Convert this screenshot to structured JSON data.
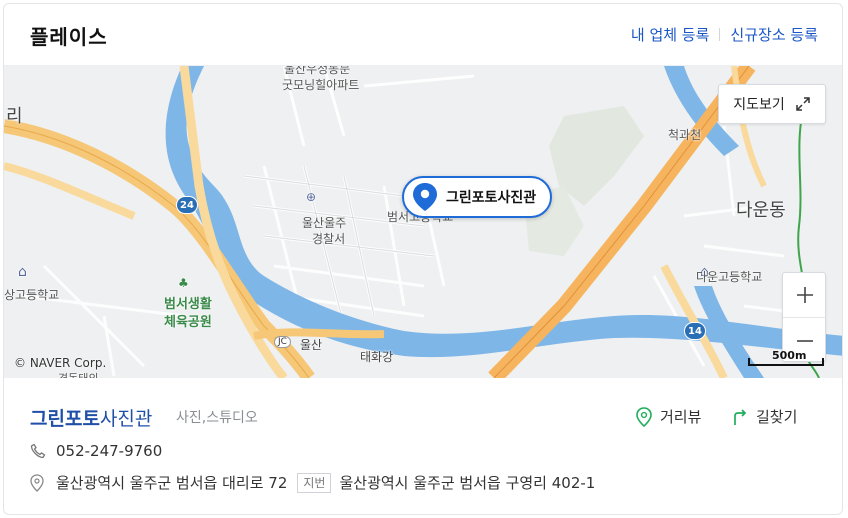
{
  "header": {
    "title": "플레이스",
    "link_register_business": "내 업체 등록",
    "link_register_new_place": "신규장소 등록"
  },
  "map": {
    "callout_name": "그린포토사진관",
    "view_map_label": "지도보기",
    "copyright": "© NAVER Corp.",
    "scale_label": "500m",
    "labels": {
      "apt": "굿모닝힐아파트",
      "apt_top": "울산우정동문",
      "ri": "리",
      "police": "울산울주\n경찰서",
      "police_line1": "울산울주",
      "police_line2": "경찰서",
      "beomseo_school": "범서고등학교",
      "cheokgwacheon": "척과천",
      "daundong": "다운동",
      "daun_school": "다운고등학교",
      "left_school": "상고등학교",
      "park_line1": "범서생활",
      "park_line2": "체육공원",
      "jc": "JC",
      "ulsan": "울산",
      "taehwagang": "태화강",
      "bottom_left": "경동태의"
    },
    "shields": [
      "24",
      "14"
    ]
  },
  "place": {
    "name_highlight": "그린포토",
    "name_rest": "사진관",
    "category": "사진,스튜디오",
    "phone": "052-247-9760",
    "road_address": "울산광역시 울주군 범서읍 대리로 72",
    "jibeon_badge": "지번",
    "jibeon_address": "울산광역시 울주군 범서읍 구영리 402-1",
    "action_street_view": "거리뷰",
    "action_directions": "길찾기"
  },
  "colors": {
    "accent": "#1f6bd8",
    "link": "#1b57c6",
    "river": "#7eb6e8",
    "highway": "#f6c776"
  }
}
